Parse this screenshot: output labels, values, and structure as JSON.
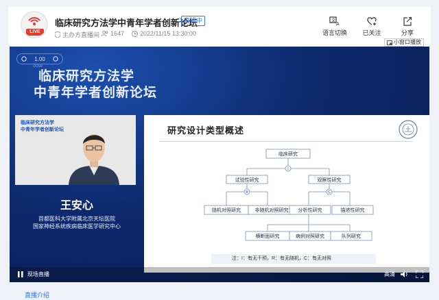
{
  "header": {
    "title": "临床研究方法学中青年学者创新论坛",
    "badge": "直播中",
    "logo_text": "LIVE",
    "host": "主办方直播间",
    "viewers": "1647",
    "datetime": "2022/11/15 13:30:00",
    "actions": [
      {
        "label": "语言切换",
        "icon": "translate-icon"
      },
      {
        "label": "已关注",
        "icon": "heart-plus-icon"
      },
      {
        "label": "分享",
        "icon": "share-icon"
      }
    ]
  },
  "player": {
    "mini_window_label": "小窗口播放",
    "speed_label": "1.00",
    "close_label": "close",
    "banner_line1": "临床研究方法学",
    "banner_line2": "中青年学者创新论坛",
    "cam_label1": "临床研究方法学",
    "cam_label2": "中青年学者创新论坛",
    "speaker_name": "王安心",
    "affiliation1": "首都医科大学附属北京天坛医院",
    "affiliation2": "国家神经系统疾病临床医学研究中心",
    "controls": {
      "live_label": "现场直播",
      "quality_label": "高清"
    }
  },
  "slide": {
    "title": "研究设计类型概述",
    "root": "临床研究",
    "level1_marker": "I",
    "experimental": "试验性研究",
    "observational": "观察性研究",
    "r_marker": "R",
    "c_marker": "C",
    "rct": "随机对照研究",
    "non_rct": "非随机对照研究",
    "analytic": "分析性研究",
    "descriptive": "描述性研究",
    "cross_sectional": "横断面研究",
    "case_control": "病例对照研究",
    "cohort": "队列研究",
    "note": "注：I：有无干预，R：有无随机，C：有无对照"
  },
  "footer": {
    "intro_tab": "直播介绍"
  },
  "colors": {
    "accent": "#2a7df0",
    "live_red": "#e33b2e",
    "player_bg": "#0a1f56"
  }
}
